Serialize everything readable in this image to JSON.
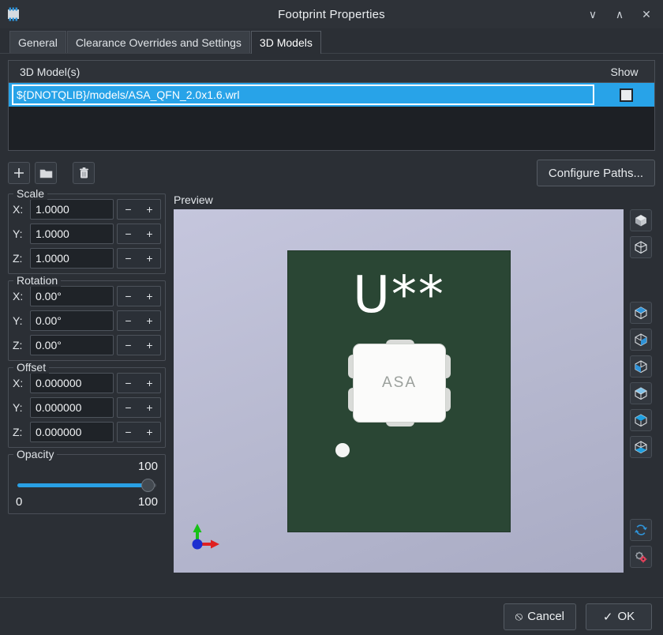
{
  "window": {
    "title": "Footprint Properties",
    "app_icon": "ic-chip-icon",
    "minimize": "∨",
    "maximize": "∧",
    "close": "✕"
  },
  "tabs": [
    {
      "label": "General",
      "active": false
    },
    {
      "label": "Clearance Overrides and Settings",
      "active": false
    },
    {
      "label": "3D Models",
      "active": true
    }
  ],
  "model_list": {
    "col_name": "3D Model(s)",
    "col_show": "Show",
    "rows": [
      {
        "path": "${DNOTQLIB}/models/ASA_QFN_2.0x1.6.wrl",
        "show": false,
        "selected": true
      }
    ]
  },
  "toolbar": {
    "add_label": "+",
    "browse_label": "folder-icon",
    "delete_label": "trash-icon",
    "configure_paths": "Configure Paths..."
  },
  "scale": {
    "title": "Scale",
    "x_label": "X:",
    "x_value": "1.0000",
    "y_label": "Y:",
    "y_value": "1.0000",
    "z_label": "Z:",
    "z_value": "1.0000",
    "minus": "−",
    "plus": "+"
  },
  "rotation": {
    "title": "Rotation",
    "x_label": "X:",
    "x_value": "0.00°",
    "y_label": "Y:",
    "y_value": "0.00°",
    "z_label": "Z:",
    "z_value": "0.00°",
    "minus": "−",
    "plus": "+"
  },
  "offset": {
    "title": "Offset",
    "x_label": "X:",
    "x_value": "0.000000",
    "y_label": "Y:",
    "y_value": "0.000000",
    "z_label": "Z:",
    "z_value": "0.000000",
    "minus": "−",
    "plus": "+"
  },
  "opacity": {
    "title": "Opacity",
    "value": "100",
    "min": "0",
    "max": "100"
  },
  "preview": {
    "label": "Preview",
    "silkscreen_text": "U**",
    "package_marking": "ASA",
    "board_color": "#2a4634",
    "background_color": "#b9bbd2",
    "axis_x_color": "#e02020",
    "axis_y_color": "#17c117",
    "axis_z_color": "#1d2fd0"
  },
  "view_rail": [
    {
      "name": "iso-view-button"
    },
    {
      "name": "wireframe-view-button"
    },
    {
      "name": "front-view-button"
    },
    {
      "name": "back-view-button"
    },
    {
      "name": "left-view-button"
    },
    {
      "name": "right-view-button"
    },
    {
      "name": "top-view-button"
    },
    {
      "name": "bottom-view-button"
    },
    {
      "name": "reload-preview-button"
    },
    {
      "name": "preview-settings-button"
    }
  ],
  "footer": {
    "cancel_label": "Cancel",
    "cancel_icon": "⦸",
    "ok_label": "OK",
    "ok_icon": "✓"
  }
}
